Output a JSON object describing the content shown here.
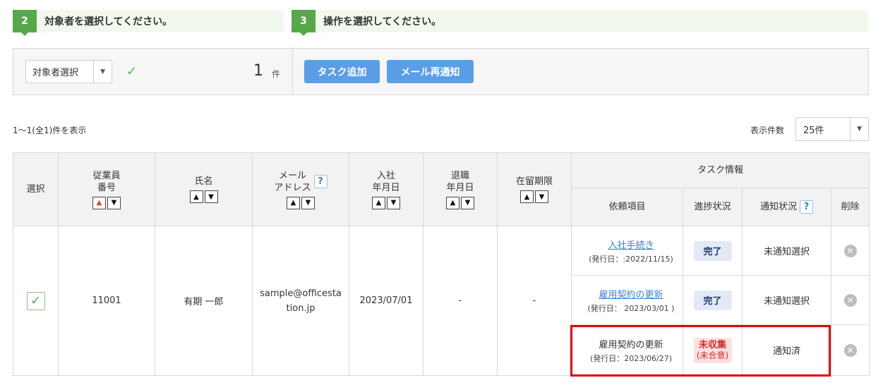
{
  "steps": [
    {
      "num": "2",
      "title": "対象者を選択してください。"
    },
    {
      "num": "3",
      "title": "操作を選択してください。"
    }
  ],
  "panel": {
    "select_label": "対象者選択",
    "count": "1",
    "count_unit": "件",
    "buttons": {
      "task_add": "タスク追加",
      "mail_resend": "メール再通知"
    }
  },
  "results": {
    "summary": "1〜1(全1)件を表示",
    "per_page_label": "表示件数",
    "per_page_value": "25件"
  },
  "table": {
    "headers": {
      "select": "選択",
      "employee_no": [
        "従業員",
        "番号"
      ],
      "name": "氏名",
      "email": [
        "メール",
        "アドレス"
      ],
      "join_date": [
        "入社",
        "年月日"
      ],
      "leave_date": [
        "退職",
        "年月日"
      ],
      "residence_limit": "在留期限",
      "task_info": "タスク情報",
      "request_item": "依頼項目",
      "progress": "進捗状況",
      "notify_status": "通知状況",
      "delete": "削除",
      "help_glyph": "?"
    },
    "row": {
      "employee_no": "11001",
      "name": "有期 一郎",
      "email": "sample@officestation.jp",
      "join_date": "2023/07/01",
      "leave_date": "-",
      "residence_limit": "-",
      "tasks": [
        {
          "item": "入社手続き",
          "date": "(発行日：:2022/11/15)",
          "progress": "完了",
          "notify": "未通知選択"
        },
        {
          "item": "雇用契約の更新",
          "date": "(発行日： 2023/03/01 )",
          "progress": "完了",
          "notify": "未通知選択"
        },
        {
          "item": "雇用契約の更新",
          "date": "(発行日：2023/06/27)",
          "progress_main": "未収集",
          "progress_sub": "(未合意)",
          "notify": "通知済"
        }
      ]
    }
  },
  "colors": {
    "step_green": "#57a84b",
    "button_blue": "#5b9ee8",
    "highlight_red": "#e00000",
    "link_blue": "#3a7fd4"
  }
}
